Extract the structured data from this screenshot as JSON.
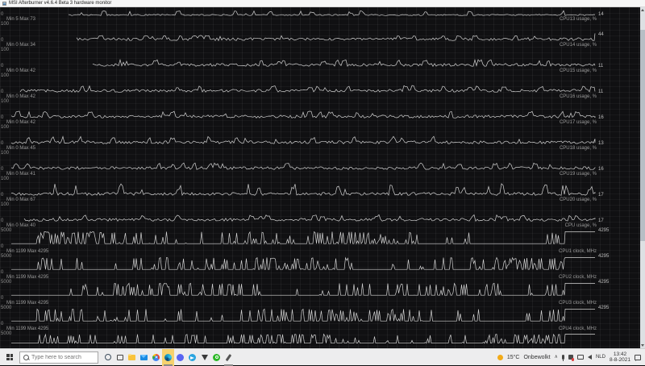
{
  "window": {
    "title": "MSI Afterburner v4.6.4 Beta 3 hardware monitor"
  },
  "monitor": {
    "axis": {
      "usage_top": "100",
      "usage_bottom": "0",
      "clock_top": "5000",
      "clock_bottom": "0"
    },
    "panes": [
      {
        "name": "CPU13 usage, %",
        "type": "usage",
        "stats": "Min 5 Max 73",
        "value": "14",
        "partial": "top"
      },
      {
        "name": "CPU14 usage, %",
        "type": "usage",
        "stats": "Min 0 Max 34",
        "value": "44"
      },
      {
        "name": "CPU15 usage, %",
        "type": "usage",
        "stats": "Min 0 Max 42",
        "value": "11"
      },
      {
        "name": "CPU16 usage, %",
        "type": "usage",
        "stats": "Min 0 Max 42",
        "value": "11"
      },
      {
        "name": "CPU17 usage, %",
        "type": "usage",
        "stats": "Min 0 Max 42",
        "value": "16"
      },
      {
        "name": "CPU18 usage, %",
        "type": "usage",
        "stats": "Min 0 Max 45",
        "value": "13"
      },
      {
        "name": "CPU19 usage, %",
        "type": "usage",
        "stats": "Min 0 Max 41",
        "value": "16"
      },
      {
        "name": "CPU20 usage, %",
        "type": "usage",
        "stats": "Min 0 Max 67",
        "value": "17"
      },
      {
        "name": "CPU usage, %",
        "type": "usage",
        "stats": "Min 0 Max 40",
        "value": "17"
      },
      {
        "name": "CPU1 clock, MHz",
        "type": "clock",
        "stats": "Min 1199 Max 4295",
        "value": "4295"
      },
      {
        "name": "CPU2 clock, MHz",
        "type": "clock",
        "stats": "Min 1199 Max 4295",
        "value": "4295"
      },
      {
        "name": "CPU3 clock, MHz",
        "type": "clock",
        "stats": "Min 1199 Max 4295",
        "value": "4295"
      },
      {
        "name": "CPU4 clock, MHz",
        "type": "clock",
        "stats": "Min 1199 Max 4295",
        "value": "4295"
      },
      {
        "type": "clock",
        "partial": "bottom"
      }
    ]
  },
  "taskbar": {
    "search_placeholder": "Type here to search",
    "apps": [
      "cortana",
      "task-view",
      "file-explorer",
      "mail",
      "chrome",
      "afterburner",
      "discord",
      "telegram",
      "vivaldi",
      "whatsapp",
      "paint"
    ],
    "tray": {
      "temperature": "15°C",
      "condition": "Onbewolkt",
      "language": "NLD",
      "time": "13:42",
      "date": "8-8-2021"
    }
  },
  "colors": {
    "window_bg": "#101012",
    "trace": "#d2d2d2",
    "taskbar_bg": "#ededee",
    "app_highlight": "#f6d26e",
    "scrollbar_track": "#dde0e3",
    "scrollbar_thumb": "#b7bec5"
  }
}
